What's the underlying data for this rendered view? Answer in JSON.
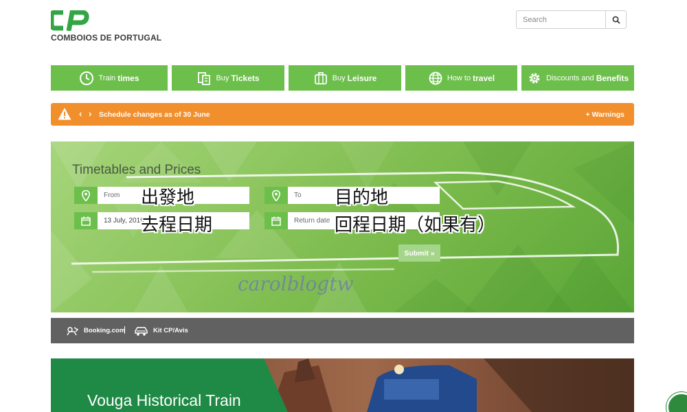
{
  "header": {
    "logo_text": "COMBOIOS DE PORTUGAL",
    "search_placeholder": "Search"
  },
  "nav": [
    {
      "pre": "Train",
      "bold": "times",
      "icon": "clock-icon"
    },
    {
      "pre": "Buy",
      "bold": "Tickets",
      "icon": "tickets-icon"
    },
    {
      "pre": "Buy",
      "bold": "Leisure",
      "icon": "suitcase-icon"
    },
    {
      "pre": "How to",
      "bold": "travel",
      "icon": "globe-icon"
    },
    {
      "pre": "Discounts and",
      "bold": "Benefits",
      "icon": "gear-icon"
    }
  ],
  "warning": {
    "prev": "‹",
    "next": "›",
    "text": "Schedule changes as of 30 June",
    "link": "+ Warnings"
  },
  "planner": {
    "title": "Timetables and Prices",
    "from_placeholder": "From",
    "to_placeholder": "To",
    "date_value": "13 July, 2019",
    "return_placeholder": "Return date",
    "submit": "Submit »",
    "annotation_from": "出發地",
    "annotation_to": "目的地",
    "annotation_date": "去程日期",
    "annotation_return": "回程日期（如果有）",
    "watermark": "carolblogtw"
  },
  "partners": {
    "booking": "Booking.com",
    "separator": "|",
    "kit": "Kit CP/Avis"
  },
  "banner": {
    "title": "Vouga Historical Train"
  },
  "colors": {
    "brand_green": "#6cbf4b",
    "warning_orange": "#f28f2d",
    "partner_gray": "#616162",
    "banner_green": "#1f8a45"
  }
}
